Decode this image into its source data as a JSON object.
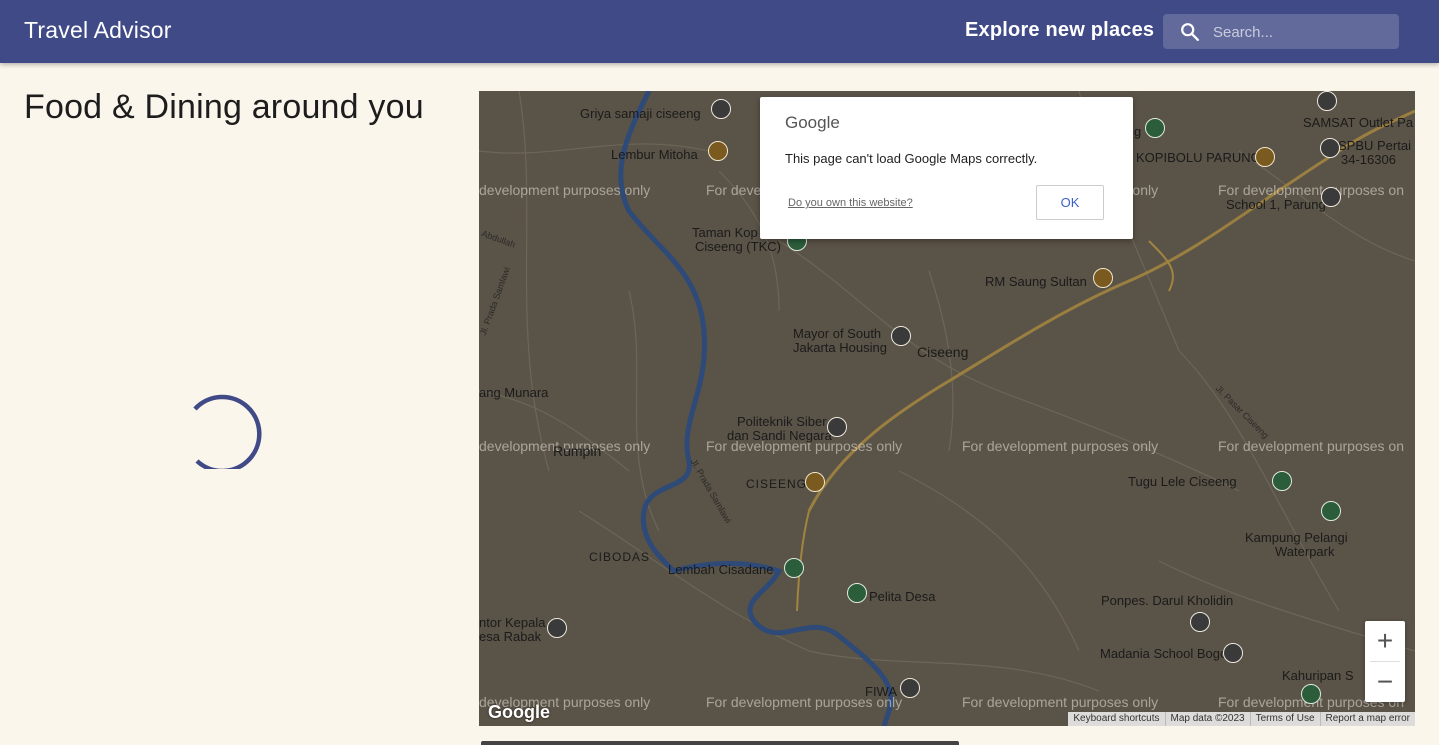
{
  "header": {
    "title": "Travel Advisor",
    "explore_label": "Explore new places",
    "search_placeholder": "Search..."
  },
  "panel": {
    "title": "Food & Dining around you"
  },
  "map": {
    "watermark": "For development purposes only",
    "watermark_left_partial": "development purposes only",
    "watermark_right_partial": "For development purposes on",
    "labels": {
      "griya": "Griya samaji ciseeng",
      "lembur": "Lembur Mitoha",
      "taman": "Taman Kop",
      "taman2": "Ciseeng (TKC)",
      "rm_saung": "RM Saung Sultan",
      "mayor": "Mayor of South",
      "mayor2": "Jakarta Housing",
      "ciseeng": "Ciseeng",
      "munara": "ang Munara",
      "politeknik": "Politeknik Siber",
      "politeknik2": "dan Sandi Negara",
      "rumpin": "Rumpin",
      "ciseeng_caps": "CISEENG",
      "cibodas": "CIBODAS",
      "lembah": "Lembah Cisadane",
      "pelita": "Pelita Desa",
      "tugu": "Tugu Lele Ciseeng",
      "kampung": "Kampung Pelangi",
      "kampung2": "Waterpark",
      "ponpes": "Ponpes. Darul Kholidin",
      "madania": "Madania School Bogor",
      "kahuripan": "Kahuripan S",
      "fiwa": "FIWA",
      "kantor": "ntor Kepala",
      "kantor2": "esa Rabak",
      "samsat": "SAMSAT Outlet Pa",
      "spbu": "SPBU Pertai",
      "spbu2": "34-16306",
      "kopibolu": "KOPIBOLU PARUNG",
      "school": "School 1, Parung",
      "g_label": "g"
    },
    "roads": {
      "abdullah": "Abdullah",
      "jl_prada": "Jl. Prada Samlawi",
      "jl_pasar": "Jl. Pasar Ciseeng",
      "jl_prada2": "Jl. Prada Samlawi"
    },
    "logo": "Google",
    "attribution": [
      "Keyboard shortcuts",
      "Map data ©2023",
      "Terms of Use",
      "Report a map error"
    ],
    "zoom_in": "+",
    "zoom_out": "−"
  },
  "dialog": {
    "logo": "Google",
    "message": "This page can't load Google Maps correctly.",
    "own_link": "Do you own this website?",
    "ok_label": "OK"
  },
  "colors": {
    "appbar": "#3f4a86",
    "background": "#faf6ec",
    "spinner": "#3f4a86",
    "map_base": "#5a5347",
    "river": "#2e4a78",
    "main_road": "#a1843f"
  },
  "icons": [
    "search-icon",
    "spinner-icon",
    "place-pin-icon",
    "restaurant-pin-icon",
    "park-pin-icon"
  ]
}
